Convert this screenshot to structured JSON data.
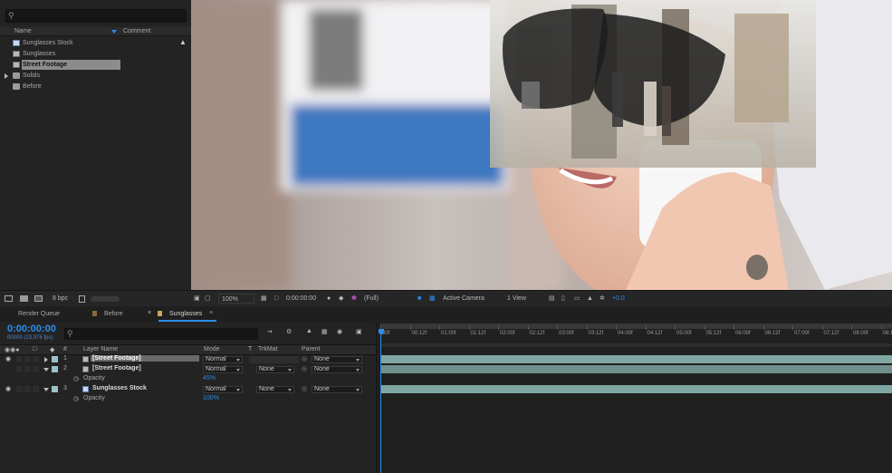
{
  "project": {
    "search_placeholder": "",
    "col_name": "Name",
    "col_comment": "Comment",
    "items": [
      {
        "label": "Sunglasses Stock",
        "kind": "comp"
      },
      {
        "label": "Sunglasses",
        "kind": "footage"
      },
      {
        "label": "Street Footage",
        "kind": "footage",
        "selected": true
      },
      {
        "label": "Solids",
        "kind": "folder"
      },
      {
        "label": "Before",
        "kind": "folder"
      }
    ],
    "bpc": "8 bpc"
  },
  "viewer": {
    "zoom": "100%",
    "timecode": "0:00:00:00",
    "resolution": "(Full)",
    "camera": "Active Camera",
    "view": "1 View",
    "exposure": "+0.0"
  },
  "tabs": {
    "render_queue": "Render Queue",
    "before": "Before",
    "sunglasses": "Sunglasses"
  },
  "timeline": {
    "current_time": "0:00:00:00",
    "fps_info": "00000 (23.976 fps)",
    "headers": {
      "num": "#",
      "layer_name": "Layer Name",
      "mode": "Mode",
      "t": "T",
      "trkmat": "TrkMat",
      "parent": "Parent"
    },
    "layers": [
      {
        "num": "1",
        "name": "[Street Footage]",
        "mode": "Normal",
        "trkmat": "",
        "parent": "None"
      },
      {
        "num": "2",
        "name": "[Street Footage]",
        "mode": "Normal",
        "trkmat": "None",
        "parent": "None"
      },
      {
        "num": "3",
        "name": "Sunglasses Stock",
        "mode": "Normal",
        "trkmat": "None",
        "parent": "None"
      }
    ],
    "opacity_label": "Opacity",
    "opacity_values": [
      {
        "value": "45",
        "unit": "%"
      },
      {
        "value": "100",
        "unit": "%"
      }
    ],
    "ruler": [
      "00f",
      "00:12f",
      "01:00f",
      "01:12f",
      "02:00f",
      "02:12f",
      "03:00f",
      "03:12f",
      "04:00f",
      "04:12f",
      "05:00f",
      "05:12f",
      "06:00f",
      "06:12f",
      "07:00f",
      "07:12f",
      "08:00f",
      "08:1"
    ]
  },
  "colors": {
    "accent": "#2d8ceb",
    "track_bar": "#7fa6a2",
    "label_teal": "#9bc3c6"
  }
}
